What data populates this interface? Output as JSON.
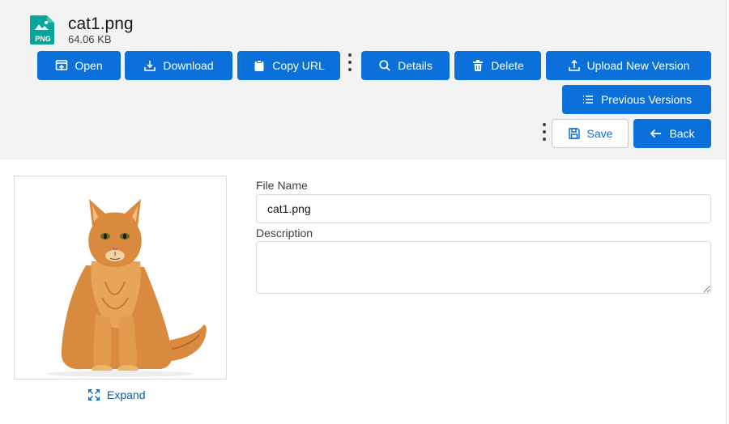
{
  "file": {
    "name": "cat1.png",
    "size": "64.06 KB",
    "type_badge": "PNG"
  },
  "toolbar": {
    "open": "Open",
    "download": "Download",
    "copy_url": "Copy URL",
    "details": "Details",
    "delete": "Delete",
    "upload_new_version": "Upload New Version",
    "previous_versions": "Previous Versions",
    "save": "Save",
    "back": "Back"
  },
  "preview": {
    "expand": "Expand"
  },
  "form": {
    "file_name_label": "File Name",
    "file_name_value": "cat1.png",
    "description_label": "Description",
    "description_value": ""
  },
  "colors": {
    "brand": "#0b70d9",
    "header_bg": "#f3f3f3",
    "png_icon": "#06a59a"
  }
}
